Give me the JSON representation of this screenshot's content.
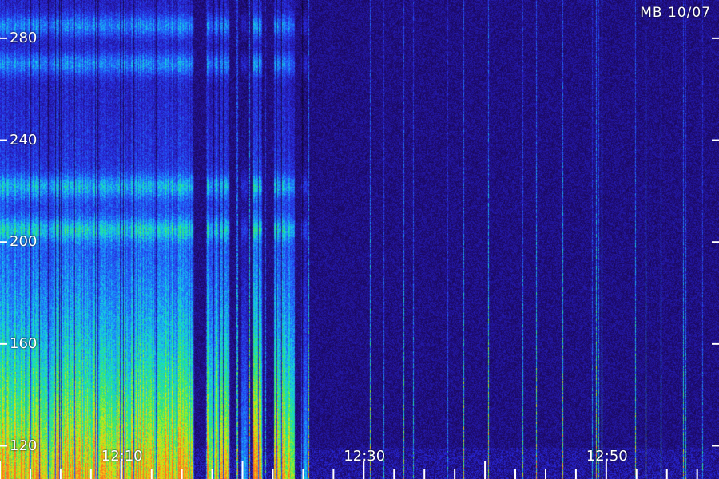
{
  "station_tag": "MB 10/07",
  "chart_data": {
    "type": "heatmap",
    "title": "",
    "xlabel": "",
    "ylabel": "",
    "x_tick_labels": [
      {
        "label": "12:10",
        "time_min": 10
      },
      {
        "label": "12:30",
        "time_min": 30
      },
      {
        "label": "12:50",
        "time_min": 50
      }
    ],
    "xlim_min": [
      0,
      59.3
    ],
    "y_ticks": [
      120,
      160,
      200,
      240,
      280
    ],
    "ylim": [
      107,
      295
    ],
    "grid": false,
    "activity_segments": [
      {
        "t_start": -1.4,
        "t_end": 15.9,
        "level": "strong"
      },
      {
        "t_start": 17.1,
        "t_end": 18.9,
        "level": "strong"
      },
      {
        "t_start": 19.9,
        "t_end": 20.3,
        "level": "medium"
      },
      {
        "t_start": 20.9,
        "t_end": 21.6,
        "level": "strong"
      },
      {
        "t_start": 22.6,
        "t_end": 24.2,
        "level": "strong"
      },
      {
        "t_start": 24.9,
        "t_end": 25.3,
        "level": "medium"
      }
    ],
    "emission_bands": [
      205,
      222,
      270,
      285
    ]
  }
}
